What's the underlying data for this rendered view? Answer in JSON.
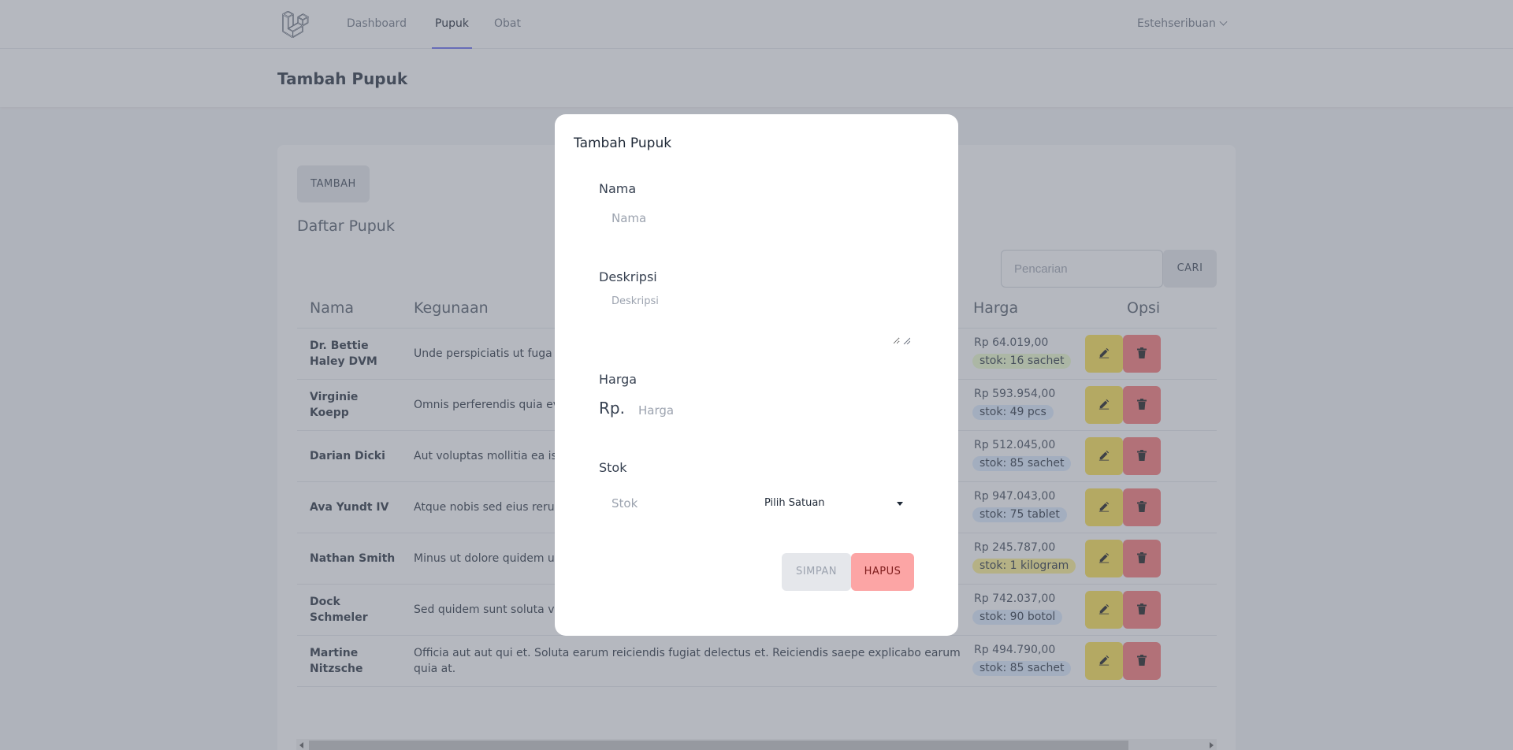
{
  "nav": {
    "links": [
      "Dashboard",
      "Pupuk",
      "Obat"
    ],
    "active": "Pupuk",
    "user": "Estehseribuan"
  },
  "header": {
    "title": "Tambah Pupuk"
  },
  "card": {
    "add_button": "TAMBAH",
    "title": "Daftar Pupuk",
    "search_placeholder": "Pencarian",
    "search_button": "CARI",
    "columns": {
      "nama": "Nama",
      "kegunaan": "Kegunaan",
      "harga": "Harga",
      "opsi": "Opsi"
    },
    "rows": [
      {
        "nama": "Dr. Bettie Haley DVM",
        "kegunaan": "Unde perspiciatis ut fuga ut a praesentium. Rerum ut et nih",
        "harga": "Rp 64.019,00",
        "stok": "stok: 16 sachet",
        "badge_color": "#ecfccb"
      },
      {
        "nama": "Virginie Koepp",
        "kegunaan": "Omnis perferendis quia even sunt. Minima nostrum dolore",
        "harga": "Rp 593.954,00",
        "stok": "stok: 49 pcs",
        "badge_color": "#dbeafe"
      },
      {
        "nama": "Darian Dicki",
        "kegunaan": "Aut voluptas mollitia ea iste harum. Dolorem magni omni",
        "harga": "Rp 512.045,00",
        "stok": "stok: 85 sachet",
        "badge_color": "#dbeafe"
      },
      {
        "nama": "Ava Yundt IV",
        "kegunaan": "Atque nobis sed eius rerum n",
        "harga": "Rp 947.043,00",
        "stok": "stok: 75 tablet",
        "badge_color": "#dbeafe"
      },
      {
        "nama": "Nathan Smith",
        "kegunaan": "Minus ut dolore quidem ut es Veniam atque voluptatum ac",
        "harga": "Rp 245.787,00",
        "stok": "stok: 1 kilogram",
        "badge_color": "#fef08a"
      },
      {
        "nama": "Dock Schmeler",
        "kegunaan": "Sed quidem sunt soluta venia exercitationem quia molestia",
        "harga": "Rp 742.037,00",
        "stok": "stok: 90 botol",
        "badge_color": "#dbeafe"
      },
      {
        "nama": "Martine Nitzsche",
        "kegunaan": "Officia aut aut qui et. Soluta earum reiciendis fugiat delectus et. Reiciendis saepe explicabo earum quia at.",
        "harga": "Rp 494.790,00",
        "stok": "stok: 85 sachet",
        "badge_color": "#dbeafe"
      }
    ]
  },
  "modal": {
    "title": "Tambah Pupuk",
    "nama_label": "Nama",
    "nama_placeholder": "Nama",
    "deskripsi_label": "Deskripsi",
    "deskripsi_placeholder": "Deskripsi",
    "harga_label": "Harga",
    "harga_prefix": "Rp.",
    "harga_placeholder": "Harga",
    "stok_label": "Stok",
    "stok_placeholder": "Stok",
    "satuan_selected": "Pilih Satuan",
    "save_button": "SIMPAN",
    "delete_button": "HAPUS"
  }
}
